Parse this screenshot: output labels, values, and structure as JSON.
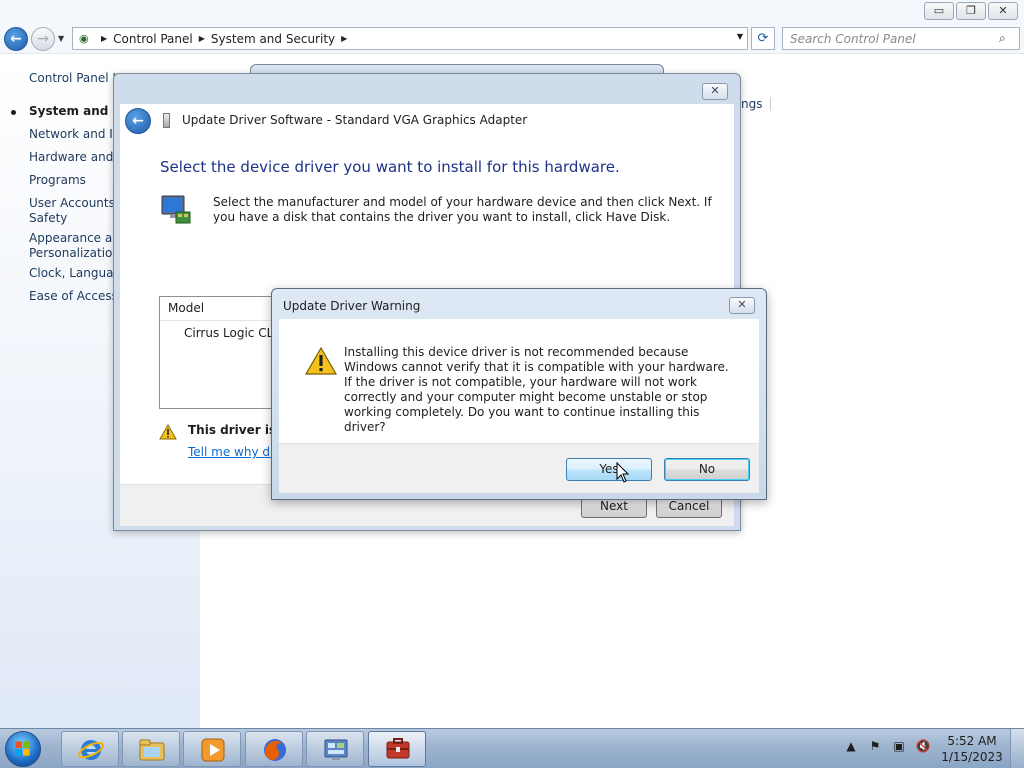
{
  "explorer": {
    "caption_buttons": {
      "minimize": "▭",
      "restore": "❐",
      "close": "✕"
    },
    "breadcrumbs": [
      "Control Panel",
      "System and Security"
    ],
    "search_placeholder": "Search Control Panel",
    "left_pane": [
      {
        "label": "Control Panel H",
        "bold": false
      },
      {
        "label": "System and Sec",
        "bold": true
      },
      {
        "label": "Network and Int",
        "bold": false
      },
      {
        "label": "Hardware and S",
        "bold": false
      },
      {
        "label": "Programs",
        "bold": false
      },
      {
        "label": "User Accounts a",
        "bold": false
      },
      {
        "label": "Safety",
        "bold": false
      },
      {
        "label": "Appearance and",
        "bold": false
      },
      {
        "label": "Personalization",
        "bold": false
      },
      {
        "label": "Clock, Language",
        "bold": false
      },
      {
        "label": "Ease of Access",
        "bold": false
      }
    ],
    "right_fragment": "ngs"
  },
  "wizard": {
    "title": "Update Driver Software - Standard VGA Graphics Adapter",
    "close_glyph": "✕",
    "heading": "Select the device driver you want to install for this hardware.",
    "instructions": "Select the manufacturer and model of your hardware device and then click Next. If you have a disk that contains the driver you want to install, click Have Disk.",
    "model_column": "Model",
    "model_row": "Cirrus Logic CL-G",
    "warning_text": "This driver is no",
    "warning_link": "Tell me why driv",
    "next_label": "Next",
    "cancel_label": "Cancel"
  },
  "warning_dialog": {
    "title": "Update Driver Warning",
    "close_glyph": "✕",
    "message": "Installing this device driver is not recommended because Windows cannot verify that it is compatible with your hardware.  If the driver is not compatible, your hardware will not work correctly and your computer might become unstable or stop working completely.  Do you want to continue installing this driver?",
    "yes_label": "Yes",
    "no_label": "No"
  },
  "taskbar": {
    "apps": [
      "internet-explorer-icon",
      "windows-explorer-icon",
      "media-player-icon",
      "firefox-icon",
      "control-panel-icon",
      "device-manager-icon"
    ],
    "tray": {
      "expand": "▲",
      "flag": "⚑",
      "network": "▣",
      "volume": "🔇"
    },
    "clock_time": "5:52 AM",
    "clock_date": "1/15/2023"
  },
  "colors": {
    "accent_heading": "#1e3287",
    "link": "#0a6ad0",
    "taskbar": "#9db4cf",
    "button_hover": "#bee6fd"
  }
}
